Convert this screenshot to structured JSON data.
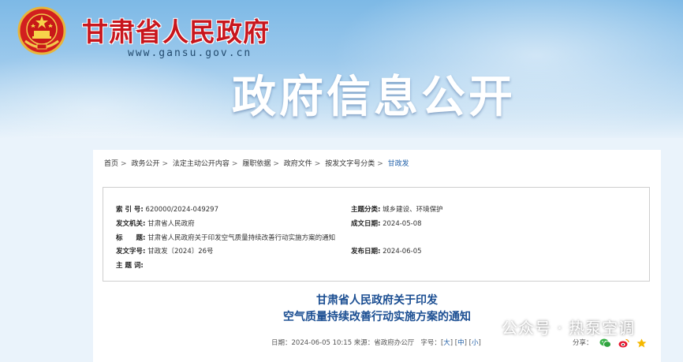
{
  "header": {
    "site_name": "甘肃省人民政府",
    "site_url": "www.gansu.gov.cn",
    "section_title": "政府信息公开"
  },
  "breadcrumb": [
    "首页",
    "政务公开",
    "法定主动公开内容",
    "履职依据",
    "政府文件",
    "按发文字号分类",
    "甘政发"
  ],
  "info": {
    "index_label": "索 引 号:",
    "index_value": "620000/2024-049297",
    "category_label": "主题分类:",
    "category_value": "城乡建设、环境保护",
    "issuer_label": "发文机关:",
    "issuer_value": "甘肃省人民政府",
    "created_label": "成文日期:",
    "created_value": "2024-05-08",
    "title_label": "标　　题:",
    "title_value": "甘肃省人民政府关于印发空气质量持续改善行动实施方案的通知",
    "docno_label": "发文字号:",
    "docno_value": "甘政发〔2024〕26号",
    "published_label": "发布日期:",
    "published_value": "2024-06-05",
    "keywords_label": "主 题 词:",
    "keywords_value": ""
  },
  "document": {
    "title_line1": "甘肃省人民政府关于印发",
    "title_line2": "空气质量持续改善行动实施方案的通知",
    "meta_date": "日期：2024-06-05 10:15 来源：省政府办公厅",
    "font_label": "字号：",
    "font_large": "大",
    "font_medium": "中",
    "font_small": "小",
    "share_label": "分享："
  },
  "watermark": {
    "text": "公众号 · 热泵空调"
  },
  "icons": [
    "national-emblem-icon",
    "wechat-icon",
    "weibo-icon",
    "qzone-icon",
    "wechat-watermark-icon"
  ],
  "colors": {
    "site_name_red": "#c8161d",
    "title_blue": "#1b4e92",
    "link_blue": "#1f5fa8"
  }
}
